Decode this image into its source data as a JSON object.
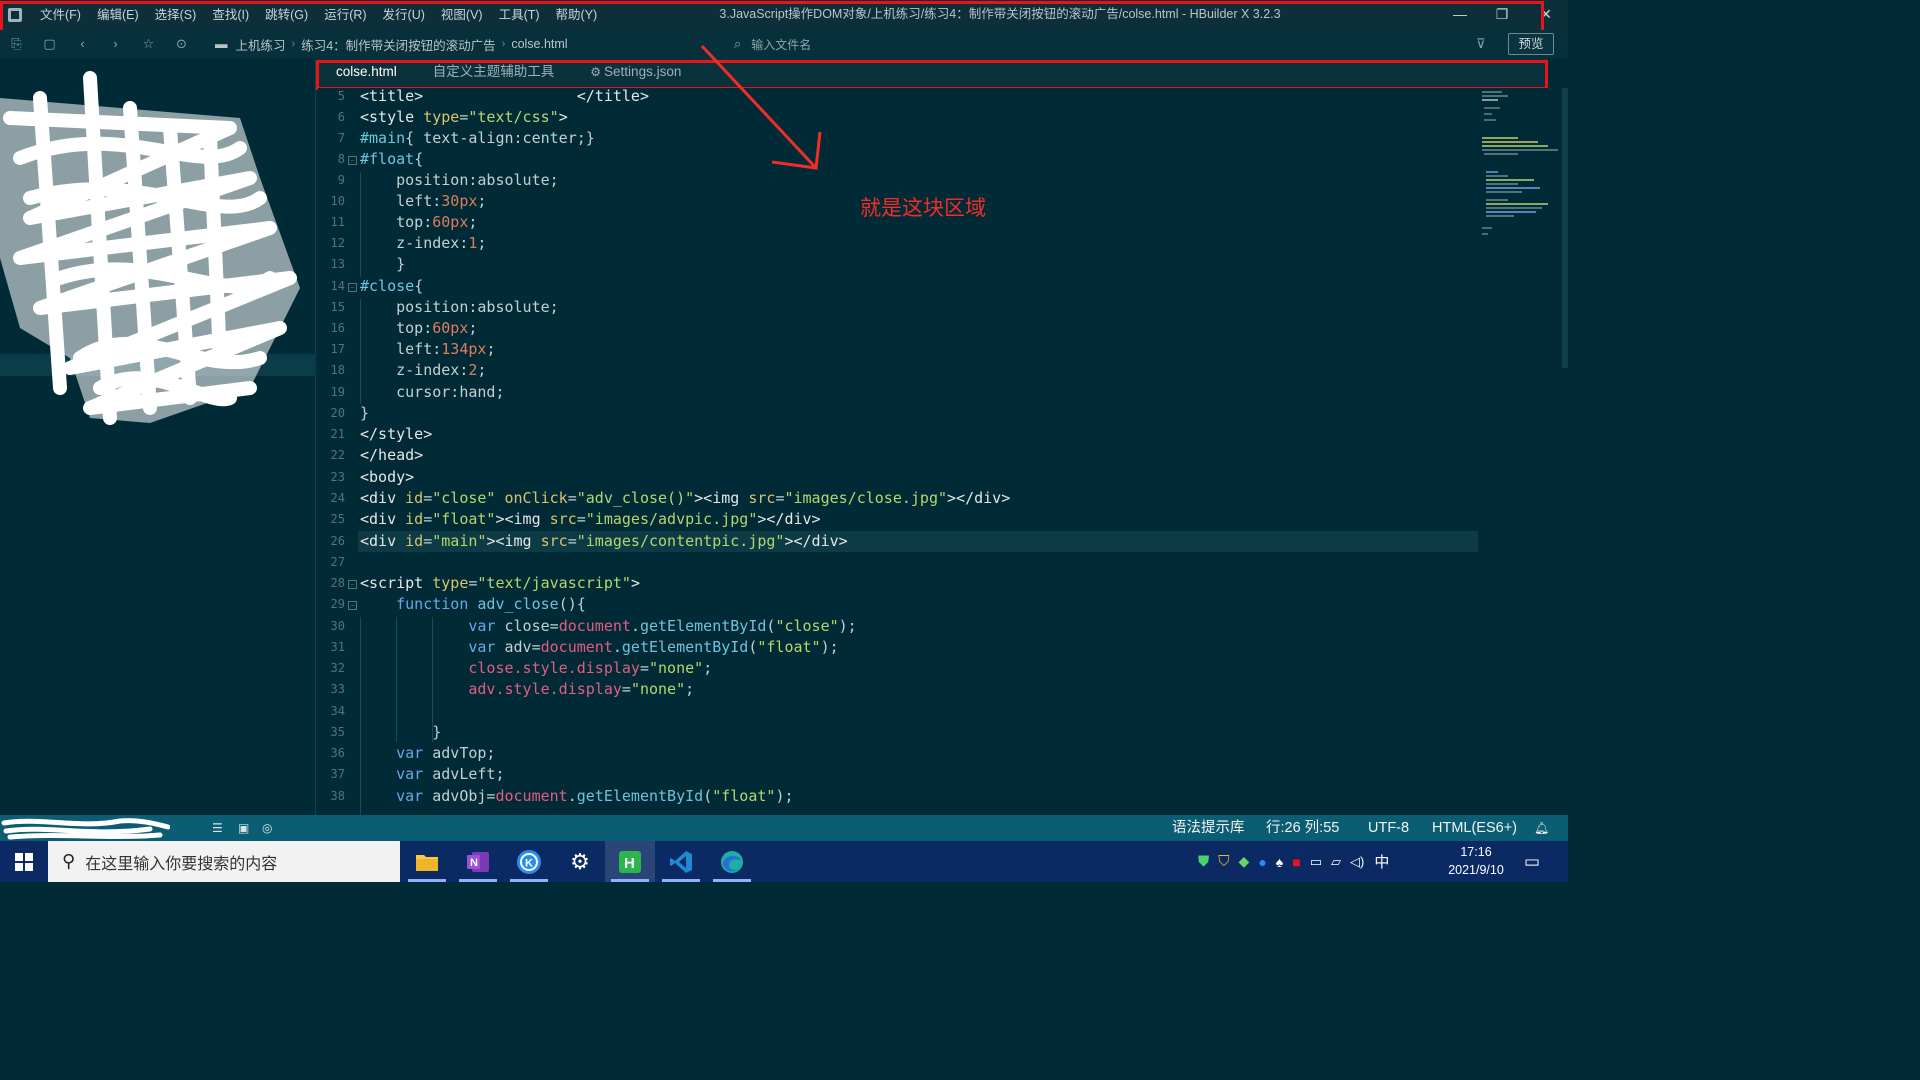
{
  "titlebar": {
    "menu": [
      "文件(F)",
      "编辑(E)",
      "选择(S)",
      "查找(I)",
      "跳转(G)",
      "运行(R)",
      "发行(U)",
      "视图(V)",
      "工具(T)",
      "帮助(Y)"
    ],
    "window_title": "3.JavaScript操作DOM对象/上机练习/练习4：制作带关闭按钮的滚动广告/colse.html - HBuilder X 3.2.3",
    "minimize": "—",
    "restore": "❐",
    "close": "✕"
  },
  "toolbar": {
    "breadcrumbs": [
      "上机练习",
      "练习4：制作带关闭按钮的滚动广告",
      "colse.html"
    ],
    "file_search_placeholder": "输入文件名",
    "preview_label": "预览"
  },
  "tabs": [
    {
      "label": "colse.html",
      "active": true
    },
    {
      "label": "自定义主题辅助工具",
      "active": false
    },
    {
      "label": "Settings.json",
      "active": false,
      "icon": "gear-icon"
    }
  ],
  "editor": {
    "line_numbers": [
      "5",
      "6",
      "7",
      "8",
      "9",
      "10",
      "11",
      "12",
      "13",
      "14",
      "15",
      "16",
      "17",
      "18",
      "19",
      "20",
      "21",
      "22",
      "23",
      "24",
      "25",
      "26",
      "27",
      "28",
      "29",
      "30",
      "31",
      "32",
      "33",
      "34",
      "35",
      "36",
      "37",
      "38"
    ],
    "fold_lines": [
      "8",
      "14",
      "28",
      "29"
    ],
    "current_line": "26"
  },
  "annotation": {
    "text": "就是这块区域",
    "color": "#f02d26"
  },
  "statusbar": {
    "syntax_lib": "语法提示库",
    "position": "行:26 列:55",
    "encoding": "UTF-8",
    "language": "HTML(ES6+)"
  },
  "taskbar": {
    "search_placeholder": "在这里输入你要搜索的内容",
    "apps": [
      "file-explorer-icon",
      "onenote-icon",
      "k-app-icon",
      "settings-icon",
      "hbuilder-icon",
      "vscode-icon",
      "edge-icon"
    ],
    "time": "17:16",
    "date": "2021/9/10",
    "ime": "中"
  },
  "colors": {
    "editor_bg": "#002b36",
    "statusbar_bg": "#0a5d72",
    "taskbar_bg": "#0b2a63",
    "highlight_frame": "#e8131b"
  }
}
